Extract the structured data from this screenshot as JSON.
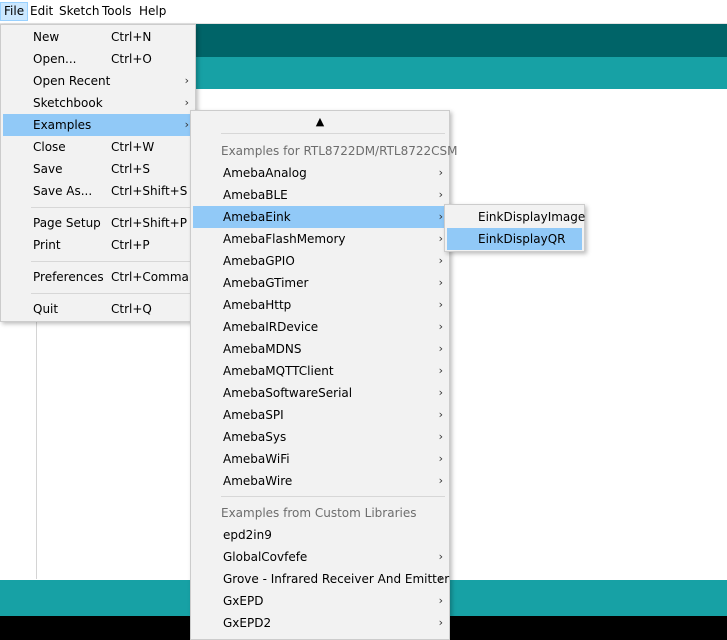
{
  "menubar": {
    "items": [
      {
        "label": "File"
      },
      {
        "label": "Edit"
      },
      {
        "label": "Sketch"
      },
      {
        "label": "Tools"
      },
      {
        "label": "Help"
      }
    ]
  },
  "file_menu": {
    "items": [
      {
        "label": "New",
        "shortcut": "Ctrl+N"
      },
      {
        "label": "Open...",
        "shortcut": "Ctrl+O"
      },
      {
        "label": "Open Recent",
        "shortcut": ""
      },
      {
        "label": "Sketchbook",
        "shortcut": ""
      },
      {
        "label": "Examples",
        "shortcut": ""
      },
      {
        "label": "Close",
        "shortcut": "Ctrl+W"
      },
      {
        "label": "Save",
        "shortcut": "Ctrl+S"
      },
      {
        "label": "Save As...",
        "shortcut": "Ctrl+Shift+S"
      },
      {
        "label": "Page Setup",
        "shortcut": "Ctrl+Shift+P"
      },
      {
        "label": "Print",
        "shortcut": "Ctrl+P"
      },
      {
        "label": "Preferences",
        "shortcut": "Ctrl+Comma"
      },
      {
        "label": "Quit",
        "shortcut": "Ctrl+Q"
      }
    ]
  },
  "examples_menu": {
    "scroll_up_glyph": "▲",
    "header_builtin": "Examples for RTL8722DM/RTL8722CSM",
    "builtin": [
      "AmebaAnalog",
      "AmebaBLE",
      "AmebaEink",
      "AmebaFlashMemory",
      "AmebaGPIO",
      "AmebaGTimer",
      "AmebaHttp",
      "AmebaIRDevice",
      "AmebaMDNS",
      "AmebaMQTTClient",
      "AmebaSoftwareSerial",
      "AmebaSPI",
      "AmebaSys",
      "AmebaWiFi",
      "AmebaWire"
    ],
    "header_custom": "Examples from Custom Libraries",
    "custom": [
      "epd2in9",
      "GlobalCovfefe",
      "Grove - Infrared Receiver And Emitter",
      "GxEPD",
      "GxEPD2"
    ]
  },
  "eink_menu": {
    "items": [
      "EinkDisplayImage",
      "EinkDisplayQR"
    ]
  },
  "colors": {
    "toolbar": "#006468",
    "tabs": "#17a1a5",
    "highlight": "#91c9f7",
    "menu_bg": "#f2f2f2"
  }
}
